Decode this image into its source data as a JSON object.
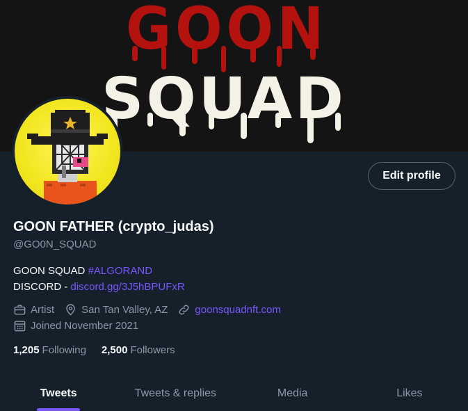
{
  "banner": {
    "line1": "GOON",
    "line2": "SQUAD"
  },
  "profile": {
    "name": "GOON FATHER (crypto_judas)",
    "handle": "@GO0N_SQUAD",
    "edit_label": "Edit profile"
  },
  "bio": {
    "line1_text": "GOON SQUAD ",
    "line1_hashtag": "#ALGORAND",
    "line2_text": "DISCORD - ",
    "line2_link": "discord.gg/3J5hBPUFxR"
  },
  "meta": {
    "category": "Artist",
    "location": "San Tan Valley, AZ",
    "website": "goonsquadnft.com",
    "joined": "Joined November 2021"
  },
  "stats": {
    "following_count": "1,205",
    "following_label": "Following",
    "followers_count": "2,500",
    "followers_label": "Followers"
  },
  "tabs": [
    {
      "label": "Tweets",
      "active": true
    },
    {
      "label": "Tweets & replies",
      "active": false
    },
    {
      "label": "Media",
      "active": false
    },
    {
      "label": "Likes",
      "active": false
    }
  ],
  "colors": {
    "background": "#15202b",
    "accent": "#7856ff",
    "banner_red": "#b3120f",
    "banner_white": "#f4f1e6",
    "avatar_yellow": "#f2e61f"
  }
}
